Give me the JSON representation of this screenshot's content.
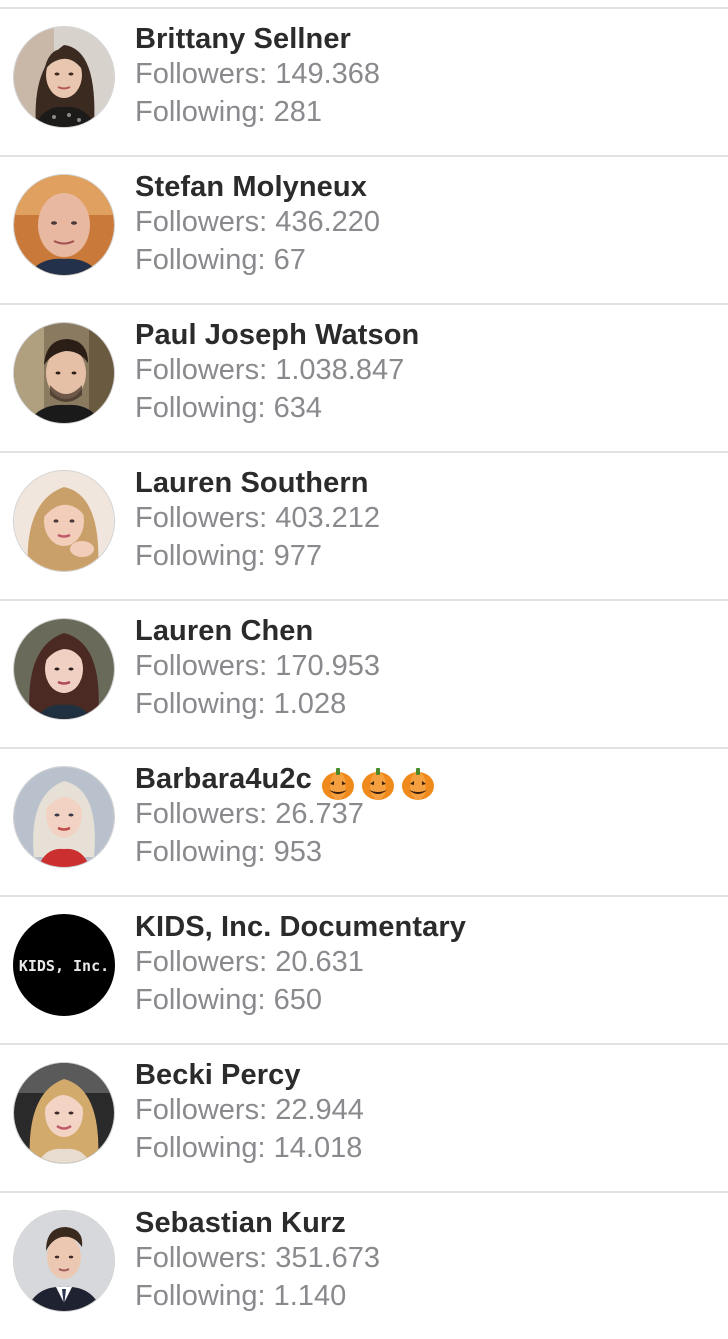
{
  "labels": {
    "followers_prefix": "Followers: ",
    "following_prefix": "Following: "
  },
  "accounts": [
    {
      "name": "Brittany Sellner",
      "followers": "149.368",
      "following": "281",
      "avatar": "portrait-woman-dark-hair-icon"
    },
    {
      "name": "Stefan Molyneux",
      "followers": "436.220",
      "following": "67",
      "avatar": "portrait-bald-man-icon"
    },
    {
      "name": "Paul Joseph Watson",
      "followers": "1.038.847",
      "following": "634",
      "avatar": "portrait-man-dark-hair-icon"
    },
    {
      "name": "Lauren Southern",
      "followers": "403.212",
      "following": "977",
      "avatar": "portrait-woman-blonde-icon"
    },
    {
      "name": "Lauren Chen",
      "followers": "170.953",
      "following": "1.028",
      "avatar": "portrait-woman-brown-hair-icon"
    },
    {
      "name": "Barbara4u2c",
      "name_suffix_emoji": [
        "pumpkin-icon",
        "pumpkin-icon",
        "pumpkin-icon"
      ],
      "followers": "26.737",
      "following": "953",
      "avatar": "portrait-woman-platinum-hair-icon"
    },
    {
      "name": "KIDS, Inc. Documentary",
      "followers": "20.631",
      "following": "650",
      "avatar": "kids-inc-logo",
      "avatar_text": "KIDS, Inc."
    },
    {
      "name": "Becki Percy",
      "followers": "22.944",
      "following": "14.018",
      "avatar": "portrait-woman-blonde-car-icon"
    },
    {
      "name": "Sebastian Kurz",
      "followers": "351.673",
      "following": "1.140",
      "avatar": "portrait-man-suit-icon"
    }
  ],
  "colors": {
    "name_text": "#2b2b2b",
    "stat_text": "#8a8a8e",
    "divider": "#e2e2e4",
    "background": "#ffffff"
  }
}
